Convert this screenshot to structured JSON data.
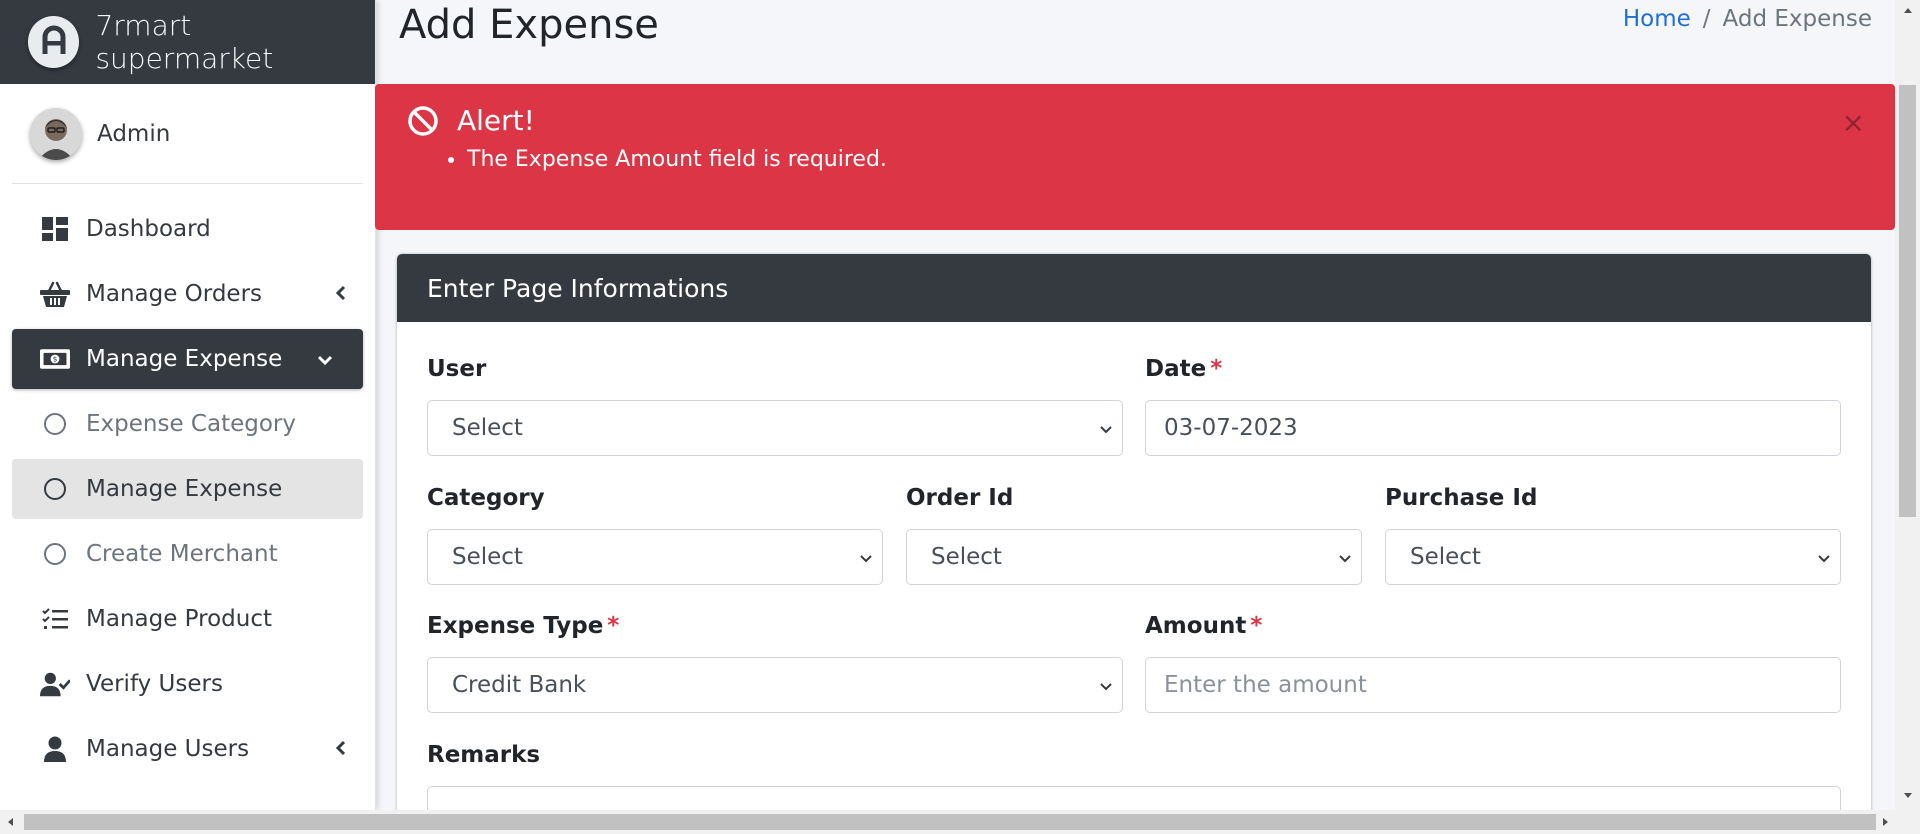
{
  "brand": {
    "name": "7rmart supermarket"
  },
  "user": {
    "name": "Admin"
  },
  "sidebar": {
    "items": [
      {
        "label": "Dashboard",
        "icon": "dashboard-icon"
      },
      {
        "label": "Manage Orders",
        "icon": "basket-icon"
      },
      {
        "label": "Manage Expense",
        "icon": "money-bill-icon"
      },
      {
        "label": "Expense Category",
        "icon": "circle-icon"
      },
      {
        "label": "Manage Expense",
        "icon": "circle-icon"
      },
      {
        "label": "Create Merchant",
        "icon": "circle-icon"
      },
      {
        "label": "Manage Product",
        "icon": "list-check-icon"
      },
      {
        "label": "Verify Users",
        "icon": "user-check-icon"
      },
      {
        "label": "Manage Users",
        "icon": "user-icon"
      }
    ]
  },
  "header": {
    "title": "Add Expense",
    "breadcrumb": {
      "home": "Home",
      "separator": "/",
      "current": "Add Expense"
    }
  },
  "alert": {
    "title": "Alert!",
    "message": "The Expense Amount field is required.",
    "close": "×",
    "color": "#dc3545"
  },
  "form": {
    "title": "Enter Page Informations",
    "required_mark": "*",
    "user": {
      "label": "User",
      "value": "Select"
    },
    "date": {
      "label": "Date",
      "value": "03-07-2023"
    },
    "category": {
      "label": "Category",
      "value": "Select"
    },
    "order_id": {
      "label": "Order Id",
      "value": "Select"
    },
    "purchase_id": {
      "label": "Purchase Id",
      "value": "Select"
    },
    "expense_type": {
      "label": "Expense Type",
      "value": "Credit Bank"
    },
    "amount": {
      "label": "Amount",
      "placeholder": "Enter the amount"
    },
    "remarks": {
      "label": "Remarks"
    }
  },
  "colors": {
    "dark": "#343a40",
    "danger": "#dc3545",
    "link": "#1f6fd6"
  }
}
